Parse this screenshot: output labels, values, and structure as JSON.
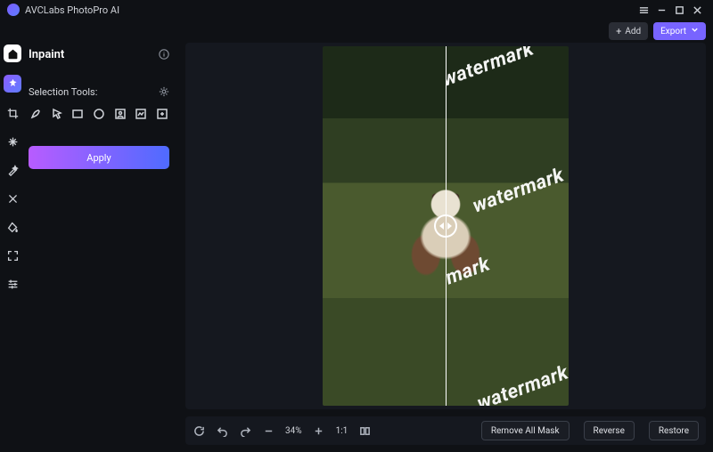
{
  "app": {
    "title": "AVCLabs PhotoPro AI"
  },
  "header": {
    "add_label": "Add",
    "export_label": "Export"
  },
  "panel": {
    "title": "Inpaint",
    "selection_label": "Selection Tools:",
    "apply_label": "Apply"
  },
  "watermark_text": "watermark",
  "bottom": {
    "zoom": "34%",
    "ratio_label": "1:1",
    "remove_all_label": "Remove All Mask",
    "reverse_label": "Reverse",
    "restore_label": "Restore"
  }
}
